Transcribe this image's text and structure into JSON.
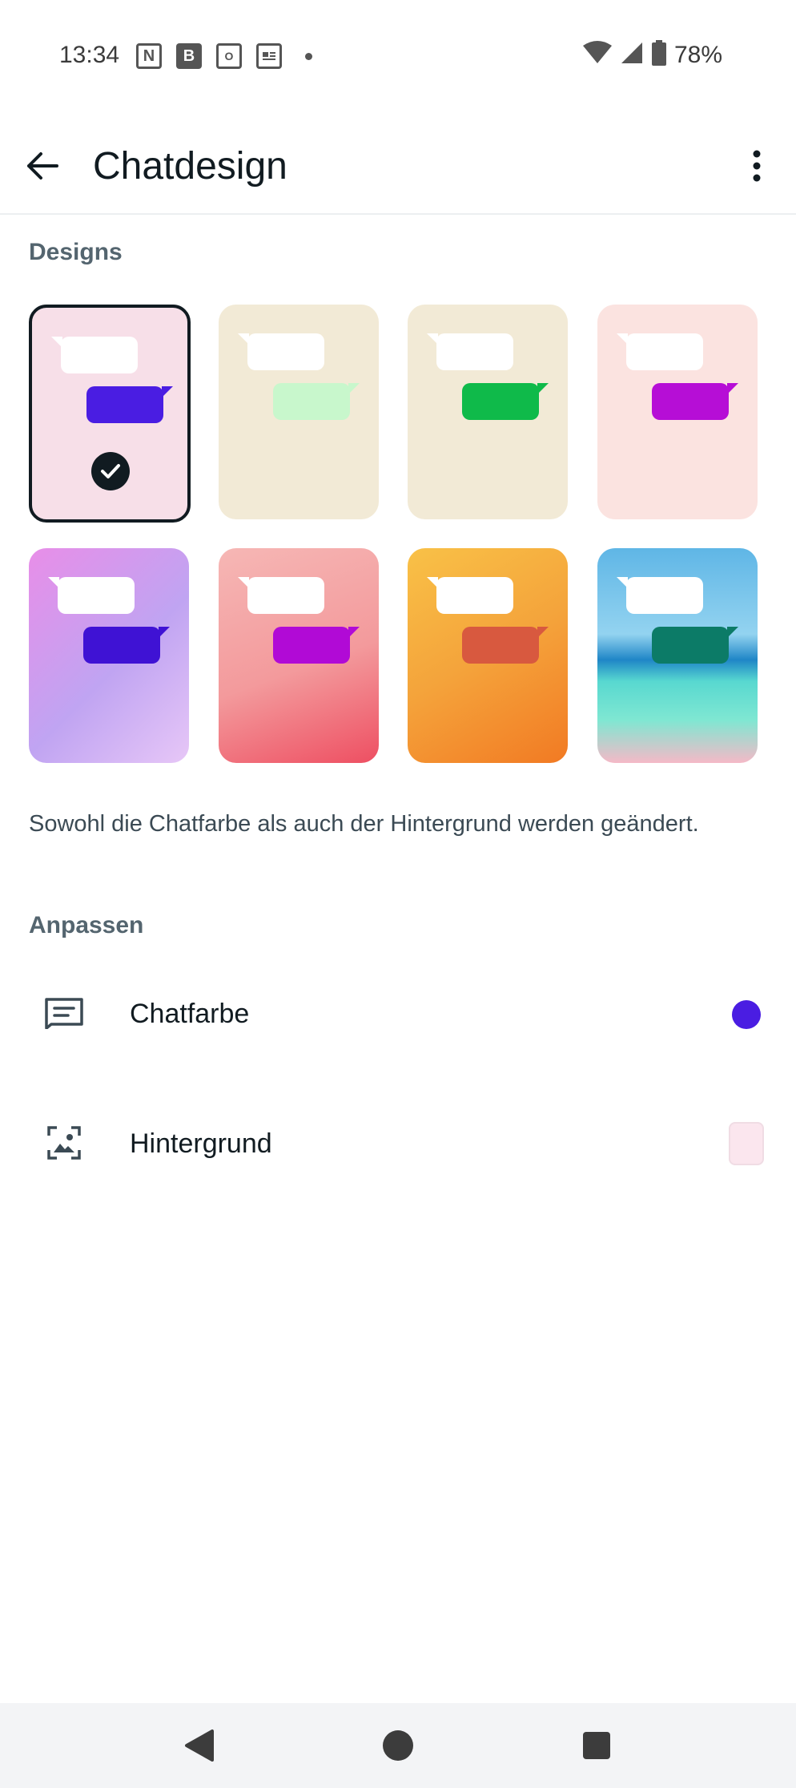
{
  "status_bar": {
    "time": "13:34",
    "notification_icons": [
      "notion-icon",
      "b-app-icon",
      "outlook-icon",
      "news-icon"
    ],
    "battery": "78%"
  },
  "app_bar": {
    "title": "Chatdesign"
  },
  "sections": {
    "designs_label": "Designs",
    "customize_label": "Anpassen"
  },
  "themes": [
    {
      "name": "pink-doodle",
      "bg": "#f7dfe8",
      "bubble": "#4a1de2",
      "selected": true
    },
    {
      "name": "beige-green-light",
      "bg": "#f2ead6",
      "bubble": "#c8f7cc",
      "selected": false
    },
    {
      "name": "beige-green",
      "bg": "#f2ead6",
      "bubble": "#0fba4a",
      "selected": false
    },
    {
      "name": "peach-purple",
      "bg": "#fbe3e0",
      "bubble": "#b60ed6",
      "selected": false
    },
    {
      "name": "violet-blur",
      "bg": "linear-gradient(135deg,#e88ee8,#c0a4f2 55%,#e7c7f7)",
      "bubble": "#3f12d4",
      "selected": false
    },
    {
      "name": "pink-flower",
      "bg": "linear-gradient(160deg,#f6b7b5,#f39a9c 55%,#ee4f62)",
      "bubble": "#b10ad6",
      "selected": false
    },
    {
      "name": "orange-petals",
      "bg": "linear-gradient(150deg,#f9c147,#f4a33b 50%,#f27a23)",
      "bubble": "#d8593f",
      "selected": false
    },
    {
      "name": "beach",
      "bg": "linear-gradient(180deg,#5fb6e6 0%,#93d3f0 40%,#1f86c7 52%,#58d8d0 62%,#7fe7d2 80%,#f5b9c7 100%)",
      "bubble": "#0c7b67",
      "selected": false
    }
  ],
  "description": "Sowohl die Chatfarbe als auch der Hintergrund werden geändert.",
  "options": {
    "chat_color": {
      "label": "Chatfarbe",
      "value_color": "#4a1de2"
    },
    "background": {
      "label": "Hintergrund",
      "value_color": "#fbe6ee"
    }
  }
}
